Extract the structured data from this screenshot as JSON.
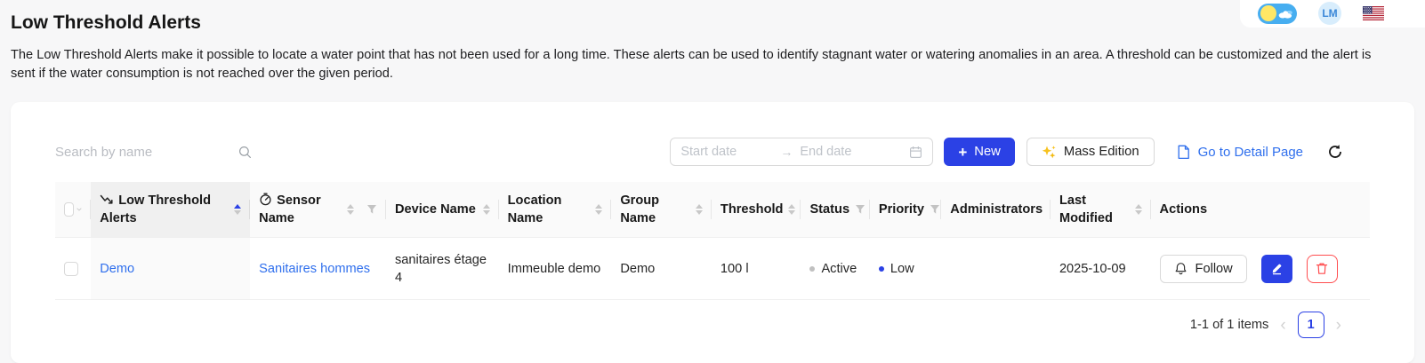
{
  "page": {
    "title": "Low Threshold Alerts",
    "description": "The Low Threshold Alerts make it possible to locate a water point that has not been used for a long time. These alerts can be used to identify stagnant water or watering anomalies in an area. A threshold can be customized and the alert is sent if the water consumption is not reached over the given period."
  },
  "topbar": {
    "avatar_initials": "LM"
  },
  "toolbar": {
    "search_placeholder": "Search by name",
    "date_range": {
      "start_placeholder": "Start date",
      "end_placeholder": "End date",
      "arrow": "→"
    },
    "new_button": {
      "plus": "+",
      "label": "New"
    },
    "mass_edition_label": "Mass Edition",
    "detail_page_label": "Go to Detail Page"
  },
  "table": {
    "columns": [
      {
        "label": "Low Threshold Alerts",
        "icon": "trend-down-icon",
        "sorted": "ascending"
      },
      {
        "label": "Sensor Name",
        "icon": "gauge-icon"
      },
      {
        "label": "Device Name"
      },
      {
        "label": "Location Name"
      },
      {
        "label": "Group Name"
      },
      {
        "label": "Threshold"
      },
      {
        "label": "Status"
      },
      {
        "label": "Priority"
      },
      {
        "label": "Administrators"
      },
      {
        "label": "Last Modified"
      },
      {
        "label": "Actions"
      }
    ],
    "rows": [
      {
        "name": "Demo",
        "sensor_name": "Sanitaires hommes",
        "device_name": "sanitaires étage 4",
        "location_name": "Immeuble demo",
        "group_name": "Demo",
        "threshold": "100 l",
        "status": "Active",
        "priority": "Low",
        "administrators": "",
        "last_modified": "2025-10-09",
        "follow_label": "Follow"
      }
    ]
  },
  "pagination": {
    "summary": "1-1 of 1 items",
    "current_page": "1"
  },
  "colors": {
    "primary": "#2b41e5",
    "link": "#2f6fed",
    "danger": "#ff4d4f",
    "status-active-dot": "#c0c0c0",
    "priority-low-dot": "#2b41e5",
    "toggle-bg": "#47aef0",
    "sun": "#ffe766"
  }
}
